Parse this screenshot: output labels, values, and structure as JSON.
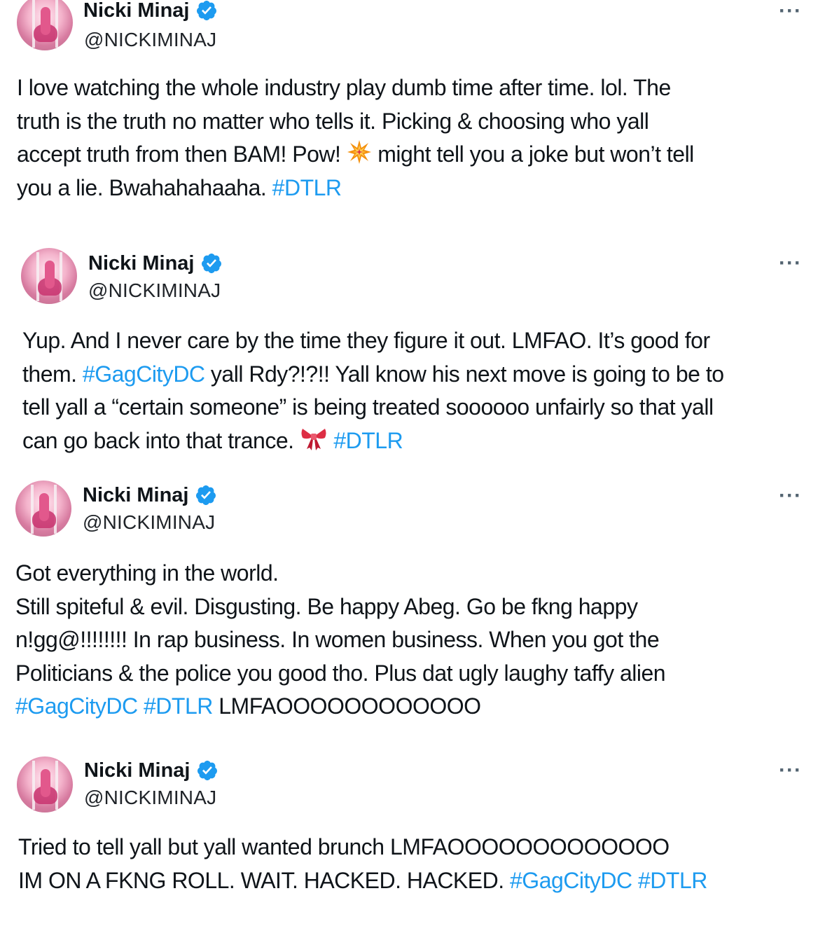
{
  "tweets": [
    {
      "name": "Nicki Minaj",
      "handle": "@NICKIMINAJ",
      "more": "···",
      "lines": [
        "I love watching the whole industry play dumb time after time. lol. The",
        "truth is the truth no matter who tells it. Picking & choosing who yall",
        "accept truth from then BAM! Pow! ",
        " might tell you a joke but won’t tell",
        "you a lie. Bwahahahaaha. ",
        "#DTLR"
      ]
    },
    {
      "name": "Nicki Minaj",
      "handle": "@NICKIMINAJ",
      "more": "···",
      "lines": [
        "Yup. And I never care by the time they figure it out. LMFAO. It’s good for",
        "them. ",
        "#GagCityDC",
        " yall Rdy?!?!! Yall know his next move is going to be to",
        "tell yall a “certain someone” is being treated soooooo unfairly so that yall",
        "can go back into that trance. ",
        "#DTLR"
      ]
    },
    {
      "name": "Nicki Minaj",
      "handle": "@NICKIMINAJ",
      "more": "···",
      "lines": [
        "Got everything in the world.",
        "Still spiteful & evil. Disgusting. Be happy Abeg. Go be fkng happy",
        "n!gg@!!!!!!!! In rap business. In women business. When you got the",
        "Politicians & the police you good tho. Plus dat ugly laughy taffy alien",
        "#GagCityDC #DTLR",
        " LMFAOOOOOOOOOOOO"
      ]
    },
    {
      "name": "Nicki Minaj",
      "handle": "@NICKIMINAJ",
      "more": "···",
      "lines": [
        "Tried to tell yall but yall wanted brunch LMFAOOOOOOOOOOOOO",
        "IM ON A FKNG ROLL. WAIT. HACKED. HACKED. ",
        "#GagCityDC #DTLR"
      ]
    }
  ],
  "icons": {
    "verified": "verified-badge-icon",
    "more": "more-options-icon",
    "collision": "collision-emoji-icon",
    "ribbon": "ribbon-emoji-icon"
  },
  "colors": {
    "hashtag": "#1d9bf0",
    "verified": "#1d9bf0",
    "text": "#0f1419",
    "muted": "#536471"
  }
}
